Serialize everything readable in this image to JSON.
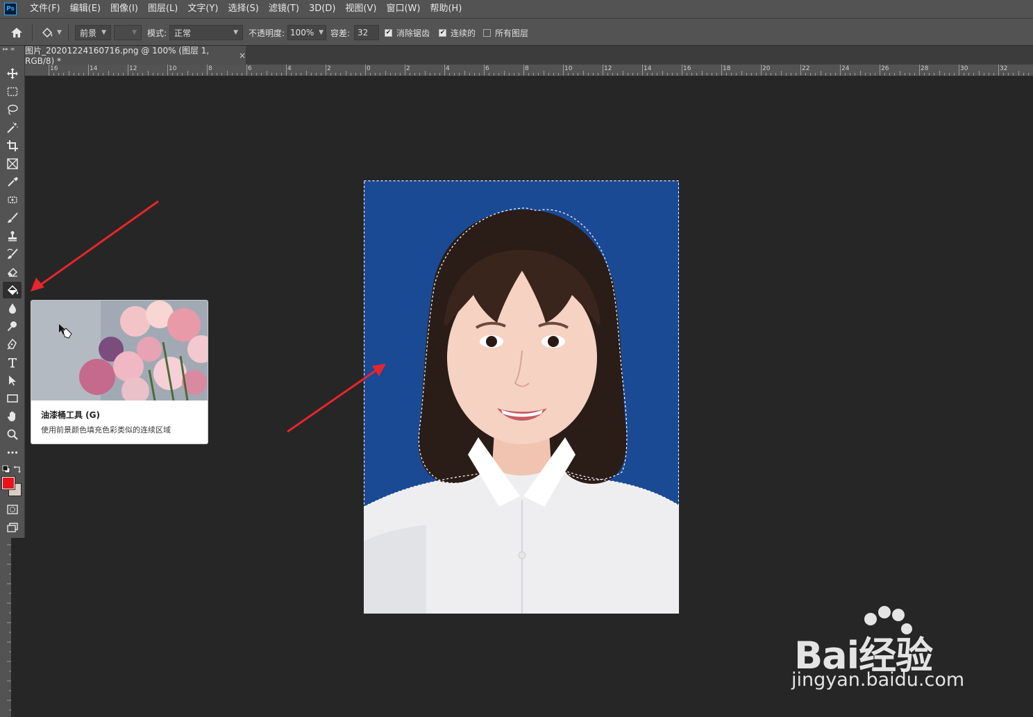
{
  "app": {
    "logo_text": "Ps",
    "menu": [
      "文件(F)",
      "编辑(E)",
      "图像(I)",
      "图层(L)",
      "文字(Y)",
      "选择(S)",
      "滤镜(T)",
      "3D(D)",
      "视图(V)",
      "窗口(W)",
      "帮助(H)"
    ]
  },
  "options_bar": {
    "fill_source": "前景",
    "mode_label": "模式:",
    "mode_value": "正常",
    "opacity_label": "不透明度:",
    "opacity_value": "100%",
    "tolerance_label": "容差:",
    "tolerance_value": "32",
    "anti_alias_label": "消除锯齿",
    "anti_alias_checked": true,
    "contiguous_label": "连续的",
    "contiguous_checked": true,
    "all_layers_label": "所有图层",
    "all_layers_checked": false
  },
  "document_tab": {
    "title": "图片_20201224160716.png @ 100% (图层 1, RGB/8) *",
    "close_glyph": "×"
  },
  "ruler": {
    "labels": [
      "16",
      "14",
      "12",
      "10",
      "8",
      "6",
      "4",
      "2",
      "0",
      "2",
      "4",
      "6",
      "8",
      "10",
      "12",
      "14",
      "16",
      "18",
      "20",
      "22",
      "24",
      "26",
      "28",
      "30",
      "32"
    ]
  },
  "toolbar": {
    "tools": [
      "move-tool",
      "marquee-tool",
      "lasso-tool",
      "magic-wand-tool",
      "crop-tool",
      "frame-tool",
      "eyedropper-tool",
      "spot-heal-tool",
      "brush-tool",
      "stamp-tool",
      "history-brush-tool",
      "eraser-tool",
      "paint-bucket-tool",
      "blur-tool",
      "dodge-tool",
      "pen-tool",
      "type-tool",
      "path-select-tool",
      "rectangle-tool",
      "hand-tool",
      "zoom-tool",
      "more-tools"
    ],
    "active_tool": "paint-bucket-tool",
    "foreground_color": "#e8141b",
    "background_color": "#d8cfc4"
  },
  "tooltip": {
    "title": "油漆桶工具 (G)",
    "description": "使用前景颜色填充色彩类似的连续区域"
  },
  "canvas": {
    "photo_background_color": "#1b4a94"
  },
  "watermark": {
    "brand": "Bai经验",
    "url": "jingyan.baidu.com"
  }
}
